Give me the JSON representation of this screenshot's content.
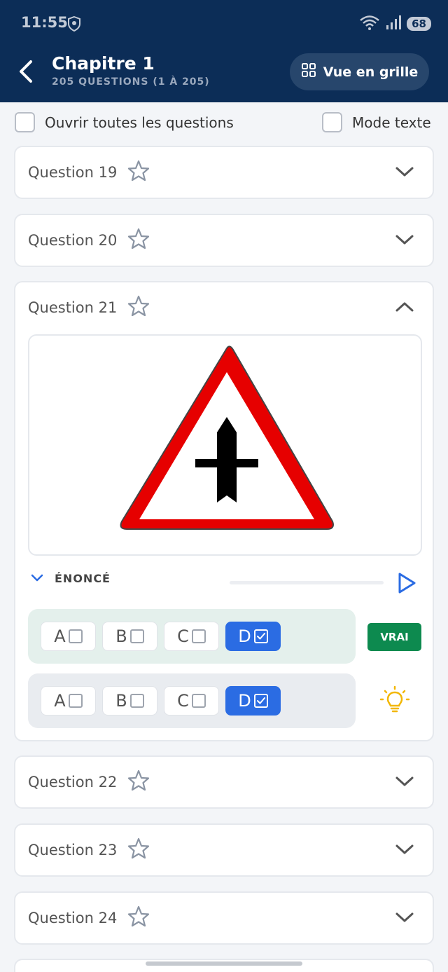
{
  "status": {
    "time": "11:55",
    "battery": "68"
  },
  "header": {
    "title": "Chapitre 1",
    "subtitle": "205 QUESTIONS (1 À 205)",
    "grid_button": "Vue en grille"
  },
  "options": {
    "open_all": "Ouvrir toutes les questions",
    "text_mode": "Mode texte"
  },
  "questions": [
    {
      "label": "Question 19"
    },
    {
      "label": "Question 20"
    },
    {
      "label": "Question 21",
      "expanded": true
    },
    {
      "label": "Question 22"
    },
    {
      "label": "Question 23"
    },
    {
      "label": "Question 24"
    }
  ],
  "expanded": {
    "enonce_label": "ÉNONCÉ",
    "answers": [
      "A",
      "B",
      "C",
      "D"
    ],
    "user_row": {
      "selected": "D"
    },
    "correct_row": {
      "selected": "D"
    },
    "result": "VRAI"
  },
  "colors": {
    "header_bg": "#0c2d57",
    "selected": "#2b6ce3",
    "correct": "#0d8a4f"
  }
}
